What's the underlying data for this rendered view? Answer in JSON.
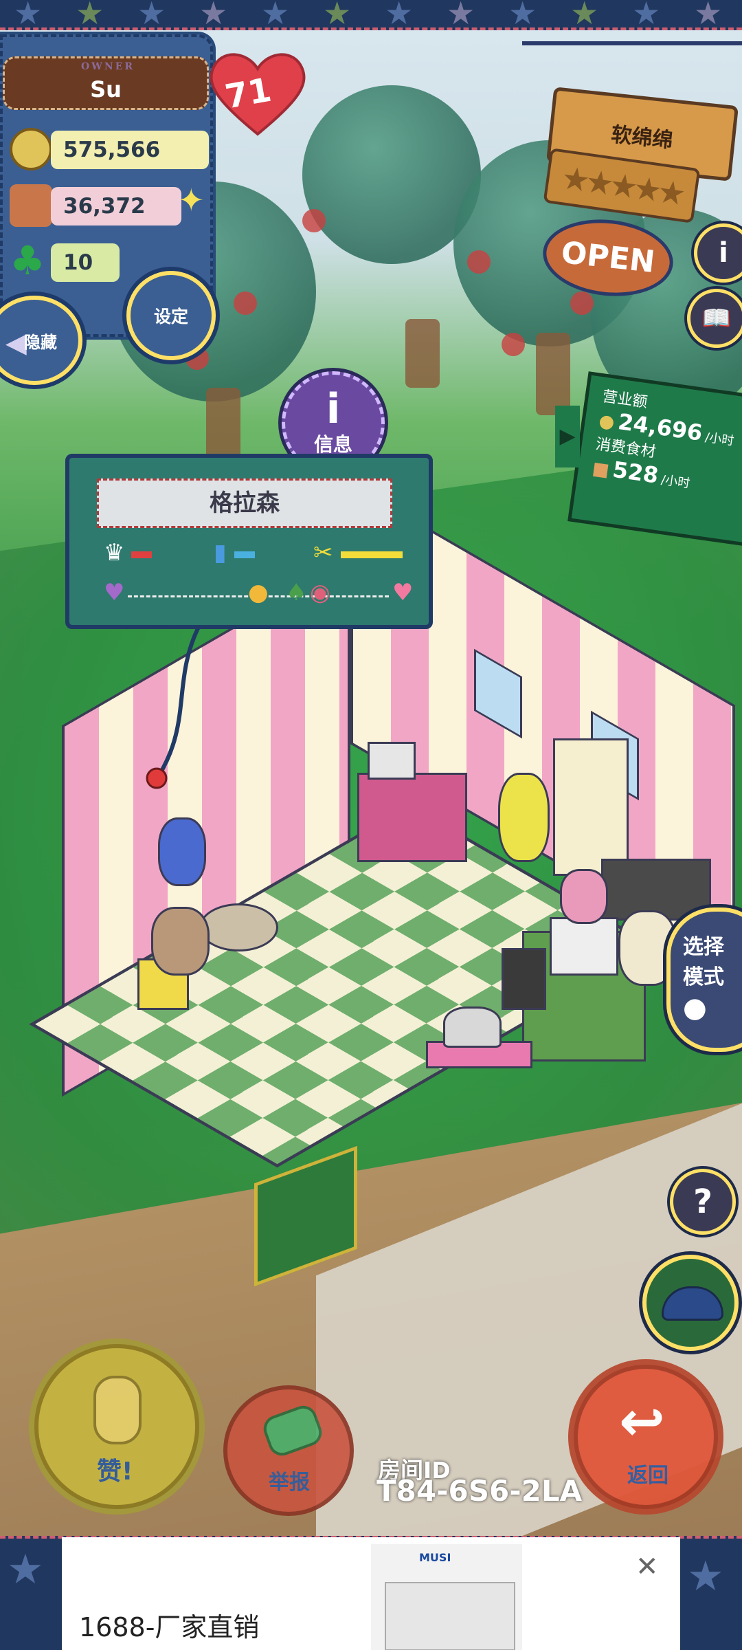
{
  "owner": {
    "tag": "OWNER",
    "name": "Su",
    "level_badge": "71"
  },
  "stats": {
    "coins": "575,566",
    "ingredients": "36,372",
    "clovers": "10"
  },
  "buttons": {
    "settings": "设定",
    "hide": "隐藏",
    "info": "信息",
    "mode_line1": "选择",
    "mode_line2": "模式",
    "help": "?",
    "like": "赞!",
    "report": "举报",
    "back": "返回"
  },
  "shop": {
    "name": "软绵绵",
    "status": "OPEN",
    "rating_stars": 5,
    "info_icon": "i"
  },
  "revenue": {
    "revenue_label": "营业额",
    "revenue_value": "24,696",
    "revenue_unit": "/小时",
    "consumption_label": "消费食材",
    "consumption_value": "528",
    "consumption_unit": "/小时"
  },
  "customer_card": {
    "name": "格拉森"
  },
  "room": {
    "id_label": "房间ID",
    "id_value": "T84-6S6-2LA"
  },
  "ad": {
    "text": "1688-厂家直销",
    "brand": "MUSI",
    "close_icon": "close-icon"
  },
  "colors": {
    "frame": "#20375f",
    "accent_yellow": "#ffe066",
    "back_orange": "#e0573a",
    "like_yellow": "#c6b640"
  }
}
